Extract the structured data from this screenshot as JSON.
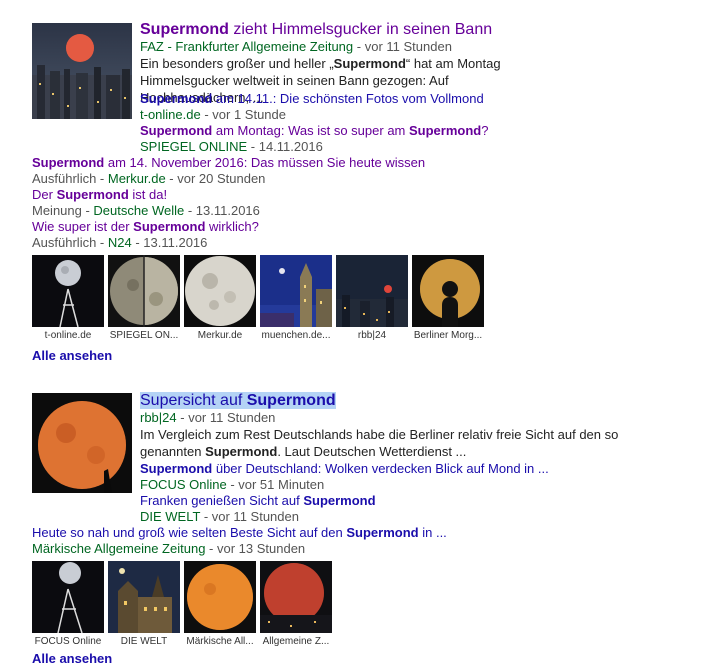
{
  "block1": {
    "main": {
      "title_pre": "Supermond",
      "title_post": " zieht Himmelsgucker in seinen Bann",
      "source_name": "FAZ - Frankfurter Allgemeine Zeitung",
      "source_time": " - vor 11 Stunden",
      "snippet_1": "Ein besonders großer und heller „",
      "snippet_bold": "Supermond",
      "snippet_2": "“ hat am Montag Himmelsgucker weltweit in seinen Bann gezogen: Auf Hochhausdächern, ..."
    },
    "sub": [
      {
        "b1": "Supermond",
        "t1": " am 14.11.: Die schönsten Fotos vom Vollmond",
        "b2": "",
        "t2": "",
        "source_name": "t-online.de",
        "source_time": " - vor 1 Stunde"
      },
      {
        "b1": "Supermond",
        "t1": " am Montag: Was ist so super am ",
        "b2": "Supermond",
        "t2": "?",
        "source_name": "SPIEGEL ONLINE",
        "source_time": " - 14.11.2016"
      }
    ],
    "more": [
      {
        "b_pre": "",
        "b1": "Supermond",
        "t1": " am 14. November 2016: Das müssen Sie heute wissen",
        "label": "Ausführlich - ",
        "source_name": "Merkur.de",
        "source_time": " - vor 20 Stunden"
      },
      {
        "b_pre": "Der ",
        "b1": "Supermond",
        "t1": " ist da!",
        "label": "Meinung - ",
        "source_name": "Deutsche Welle",
        "source_time": " - 13.11.2016"
      },
      {
        "b_pre": "Wie super ist der ",
        "b1": "Supermond",
        "t1": " wirklich?",
        "label": "Ausführlich - ",
        "source_name": "N24",
        "source_time": " - 13.11.2016"
      }
    ],
    "thumbs": [
      "t-online.de",
      "SPIEGEL ON...",
      "Merkur.de",
      "muenchen.de...",
      "rbb|24",
      "Berliner Morg..."
    ],
    "see_all": "Alle ansehen"
  },
  "block2": {
    "main": {
      "title_pre": "Supersicht auf ",
      "title_bold": "Supermond",
      "source_name": "rbb|24",
      "source_time": " - vor 11 Stunden",
      "snippet_1": "Im Vergleich zum Rest Deutschlands habe die Berliner relativ freie Sicht auf den so genannten ",
      "snippet_bold": "Supermond",
      "snippet_2": ". Laut Deutschen Wetterdienst ..."
    },
    "sub": [
      {
        "b1": "Supermond",
        "t1": " über Deutschland: Wolken verdecken Blick auf Mond in ...",
        "source_name": "FOCUS Online",
        "source_time": " - vor 51 Minuten"
      },
      {
        "pre": "Franken genießen Sicht auf ",
        "b1": "Supermond",
        "source_name": "DIE WELT",
        "source_time": " - vor 11 Stunden"
      }
    ],
    "more": {
      "pre": "Heute so nah und groß wie selten Beste Sicht auf den ",
      "b1": "Supermond",
      "t1": " in ...",
      "source_name": "Märkische Allgemeine Zeitung",
      "source_time": " - vor 13 Stunden"
    },
    "thumbs": [
      "FOCUS Online",
      "DIE WELT",
      "Märkische All...",
      "Allgemeine Z..."
    ],
    "see_all": "Alle ansehen"
  }
}
